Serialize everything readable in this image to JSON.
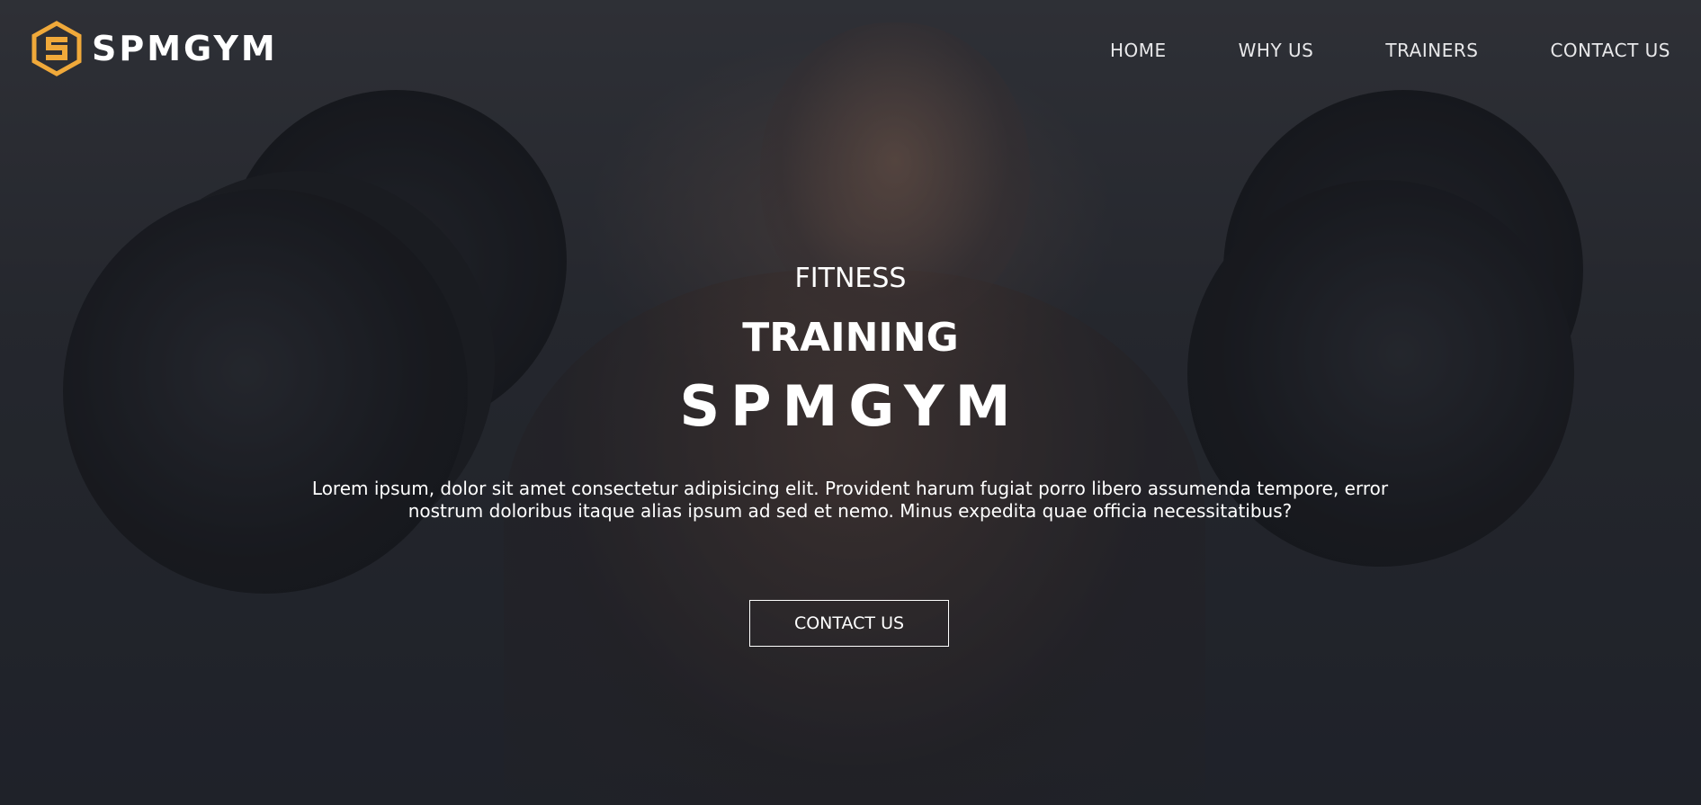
{
  "brand": {
    "name": "SPMGYM",
    "logo_icon": "hexagon-s-logo-icon",
    "logo_color": "#f0a93a"
  },
  "nav": {
    "items": [
      {
        "label": "HOME"
      },
      {
        "label": "WHY US"
      },
      {
        "label": "TRAINERS"
      },
      {
        "label": "CONTACT US"
      }
    ]
  },
  "hero": {
    "kicker": "FITNESS",
    "subtitle": "TRAINING",
    "title": "SPMGYM",
    "description": "Lorem ipsum, dolor sit amet consectetur adipisicing elit. Provident harum fugiat porro libero assumenda tempore, error nostrum doloribus itaque alias ipsum ad sed et nemo. Minus expedita quae officia necessitatibus?",
    "cta_label": "CONTACT US"
  },
  "colors": {
    "accent": "#f0a93a",
    "text": "#ffffff",
    "background": "#22252d"
  }
}
